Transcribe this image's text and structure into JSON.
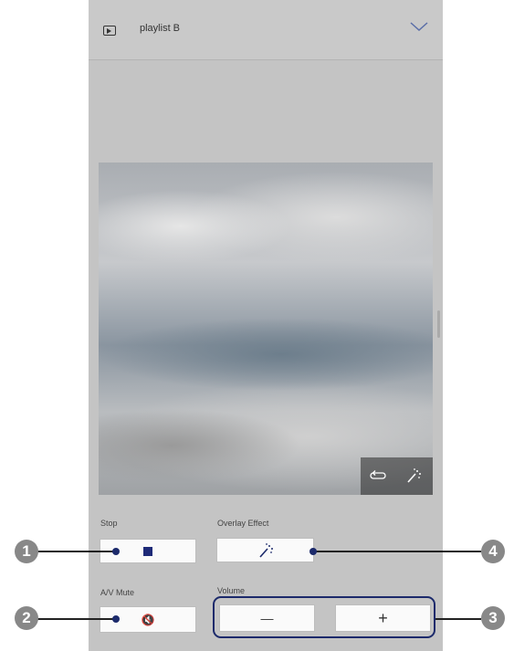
{
  "header": {
    "title": "playlist B",
    "play_icon": "play-icon",
    "dropdown_icon": "chevron-down-icon"
  },
  "preview": {
    "overlay_icons": [
      "repeat-icon",
      "magic-wand-icon"
    ]
  },
  "controls": {
    "stop_label": "Stop",
    "overlay_label": "Overlay Effect",
    "av_mute_label": "A/V Mute",
    "volume_label": "Volume",
    "volume_down_symbol": "—",
    "volume_up_symbol": "+",
    "mute_symbol": "🔇"
  },
  "callouts": [
    "1",
    "2",
    "3",
    "4"
  ],
  "colors": {
    "accent": "#1c2a6b",
    "panel": "#c4c4c4",
    "callout": "#888888"
  }
}
